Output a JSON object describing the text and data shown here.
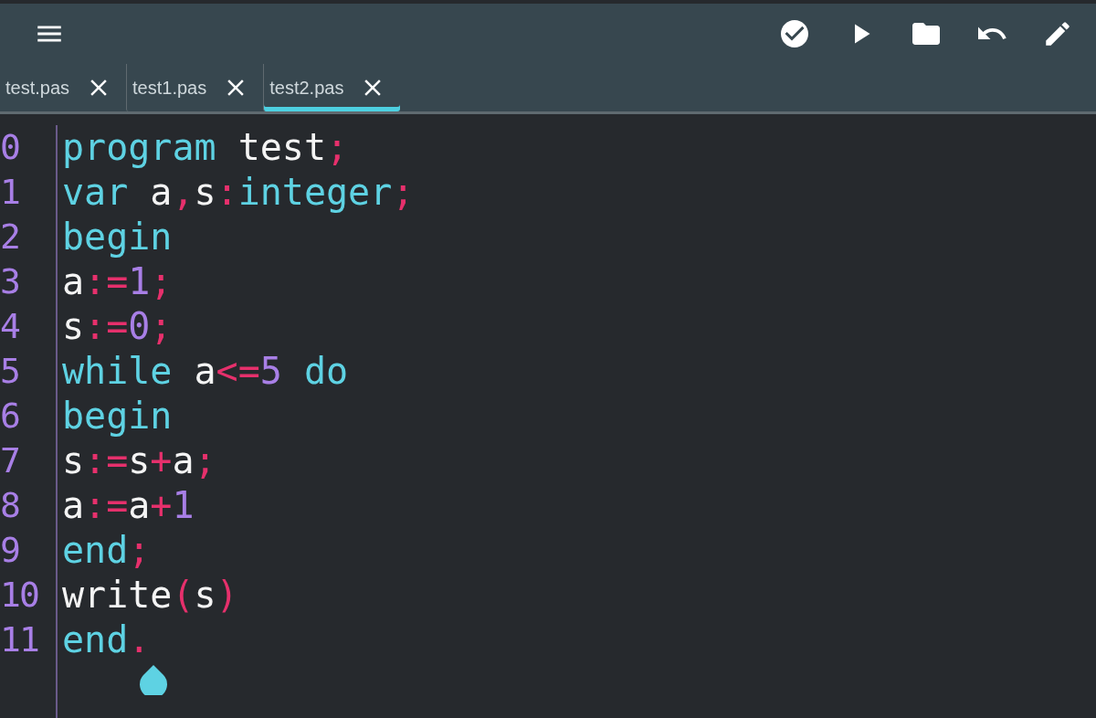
{
  "tabs": [
    {
      "label": "test.pas",
      "selected": false
    },
    {
      "label": "test1.pas",
      "selected": false
    },
    {
      "label": "test2.pas",
      "selected": true
    }
  ],
  "lines": [
    {
      "number": "0",
      "tokens": [
        {
          "kind": "keyword",
          "text": "program"
        },
        {
          "kind": "ident",
          "text": " test"
        },
        {
          "kind": "punct",
          "text": ";"
        }
      ]
    },
    {
      "number": "1",
      "tokens": [
        {
          "kind": "keyword",
          "text": "var"
        },
        {
          "kind": "ident",
          "text": " a"
        },
        {
          "kind": "punct",
          "text": ","
        },
        {
          "kind": "ident",
          "text": "s"
        },
        {
          "kind": "punct",
          "text": ":"
        },
        {
          "kind": "keyword",
          "text": "integer"
        },
        {
          "kind": "punct",
          "text": ";"
        }
      ]
    },
    {
      "number": "2",
      "tokens": [
        {
          "kind": "keyword",
          "text": "begin"
        }
      ]
    },
    {
      "number": "3",
      "tokens": [
        {
          "kind": "ident",
          "text": "a"
        },
        {
          "kind": "punct",
          "text": ":="
        },
        {
          "kind": "number",
          "text": "1"
        },
        {
          "kind": "punct",
          "text": ";"
        }
      ]
    },
    {
      "number": "4",
      "tokens": [
        {
          "kind": "ident",
          "text": "s"
        },
        {
          "kind": "punct",
          "text": ":="
        },
        {
          "kind": "number",
          "text": "0"
        },
        {
          "kind": "punct",
          "text": ";"
        }
      ]
    },
    {
      "number": "5",
      "tokens": [
        {
          "kind": "keyword",
          "text": "while"
        },
        {
          "kind": "ident",
          "text": " a"
        },
        {
          "kind": "punct",
          "text": "<="
        },
        {
          "kind": "number",
          "text": "5"
        },
        {
          "kind": "keyword",
          "text": " do"
        }
      ]
    },
    {
      "number": "6",
      "tokens": [
        {
          "kind": "keyword",
          "text": "begin"
        }
      ]
    },
    {
      "number": "7",
      "tokens": [
        {
          "kind": "ident",
          "text": "s"
        },
        {
          "kind": "punct",
          "text": ":="
        },
        {
          "kind": "ident",
          "text": "s"
        },
        {
          "kind": "punct",
          "text": "+"
        },
        {
          "kind": "ident",
          "text": "a"
        },
        {
          "kind": "punct",
          "text": ";"
        }
      ]
    },
    {
      "number": "8",
      "tokens": [
        {
          "kind": "ident",
          "text": "a"
        },
        {
          "kind": "punct",
          "text": ":="
        },
        {
          "kind": "ident",
          "text": "a"
        },
        {
          "kind": "punct",
          "text": "+"
        },
        {
          "kind": "number",
          "text": "1"
        }
      ]
    },
    {
      "number": "9",
      "tokens": [
        {
          "kind": "keyword",
          "text": "end"
        },
        {
          "kind": "punct",
          "text": ";"
        }
      ]
    },
    {
      "number": "10",
      "tokens": [
        {
          "kind": "ident",
          "text": "write"
        },
        {
          "kind": "punct",
          "text": "("
        },
        {
          "kind": "ident",
          "text": "s"
        },
        {
          "kind": "punct",
          "text": ")"
        }
      ]
    },
    {
      "number": "11",
      "tokens": [
        {
          "kind": "keyword",
          "text": "end"
        },
        {
          "kind": "punct",
          "text": "."
        }
      ]
    }
  ]
}
